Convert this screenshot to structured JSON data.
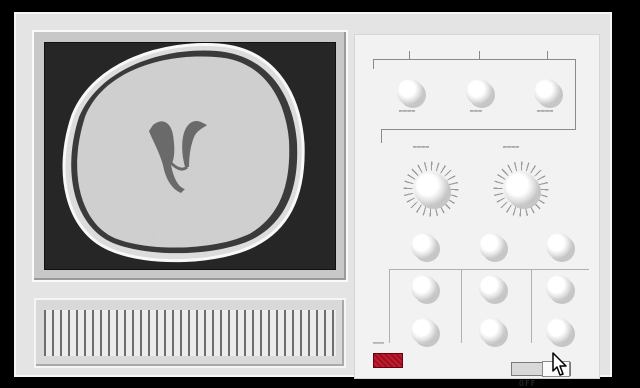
{
  "monitor": {
    "image": "brain-ct-scan"
  },
  "controls": {
    "top_knobs": [
      "knob-1",
      "knob-2",
      "knob-3"
    ],
    "dials": [
      "dial-left",
      "dial-right"
    ],
    "middle_knobs": [
      "knob-4",
      "knob-5",
      "knob-6"
    ],
    "lower_grid": [
      "knob-7",
      "knob-8",
      "knob-9",
      "knob-10",
      "knob-11",
      "knob-12"
    ]
  },
  "power": {
    "switch_label": "OFF",
    "switch_state": "off",
    "led_color": "#b01526"
  },
  "colors": {
    "cabinet": "#e4e4e4",
    "panel": "#f2f2f2",
    "screen": "#262626"
  }
}
